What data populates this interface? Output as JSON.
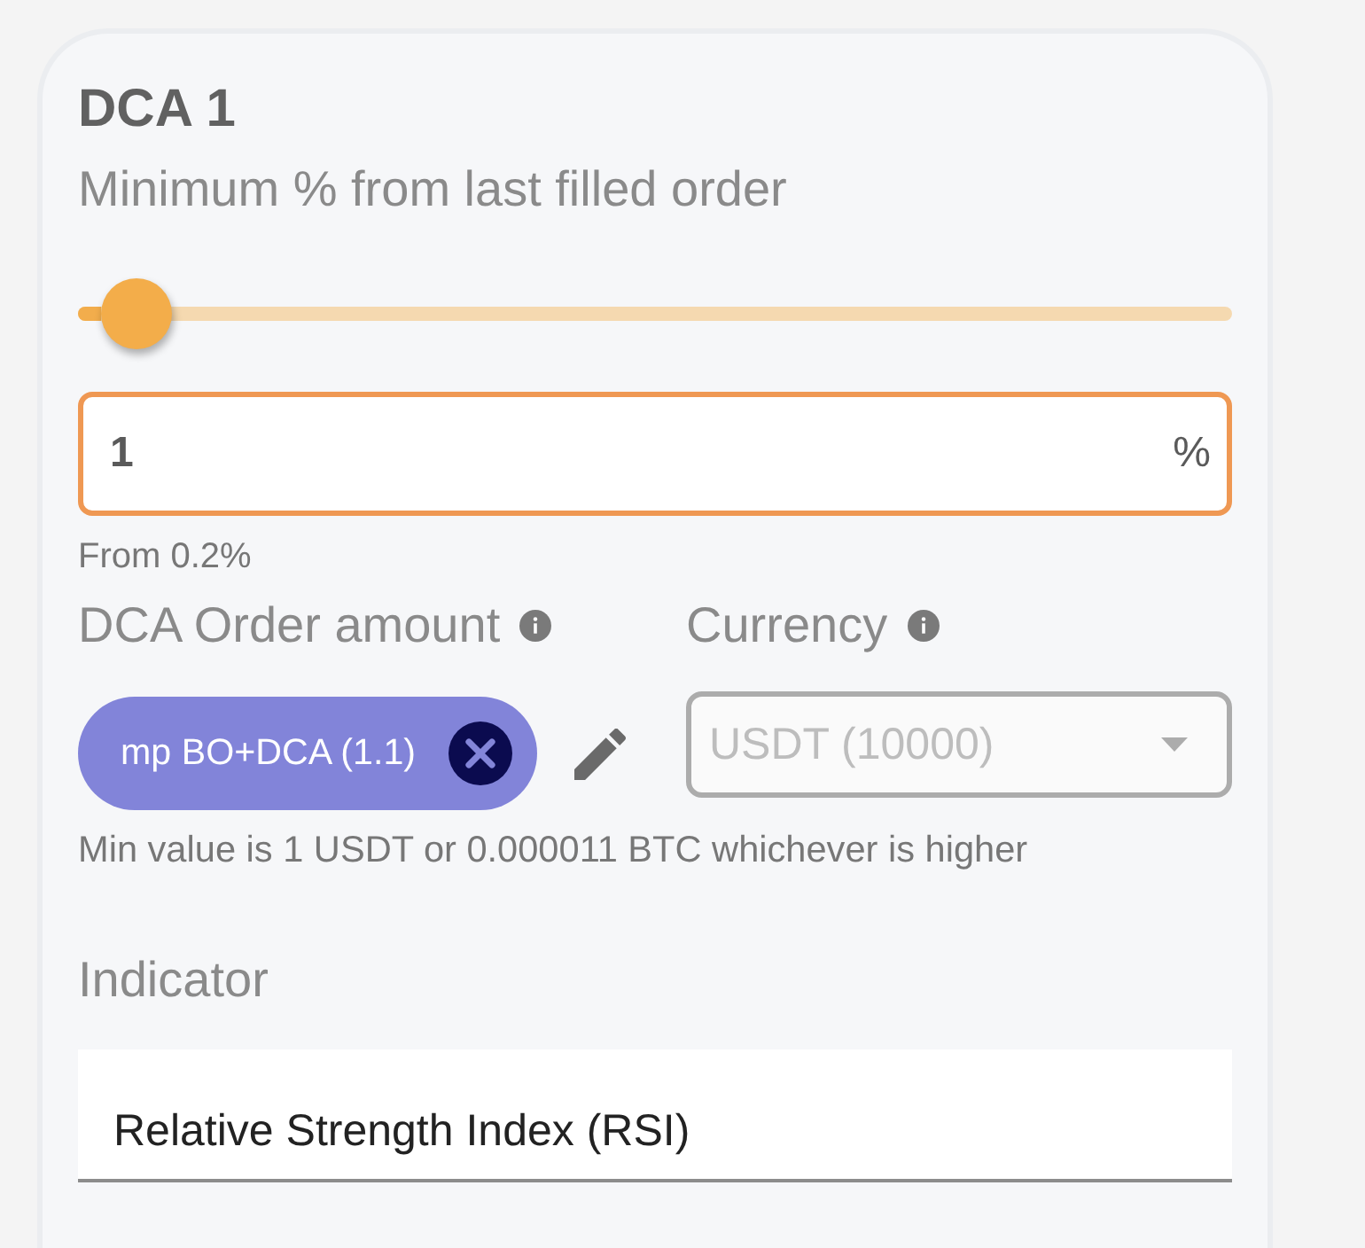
{
  "card": {
    "title": "DCA 1",
    "min_step": {
      "label": "Minimum % from last filled order",
      "level": 0.05,
      "value": "1",
      "suffix": "%",
      "focused": true,
      "hint": "From 0.2%"
    },
    "order_amount": {
      "label": "DCA Order amount",
      "chip": "mp BO+DCA (1.1)"
    },
    "currency": {
      "label": "Currency",
      "value": "USDT (10000)",
      "disabled": true
    },
    "amount_hint": "Min value is 1 USDT or 0.000011 BTC whichever is higher",
    "indicator": {
      "label": "Indicator",
      "value": "Relative Strength Index (RSI)"
    }
  }
}
